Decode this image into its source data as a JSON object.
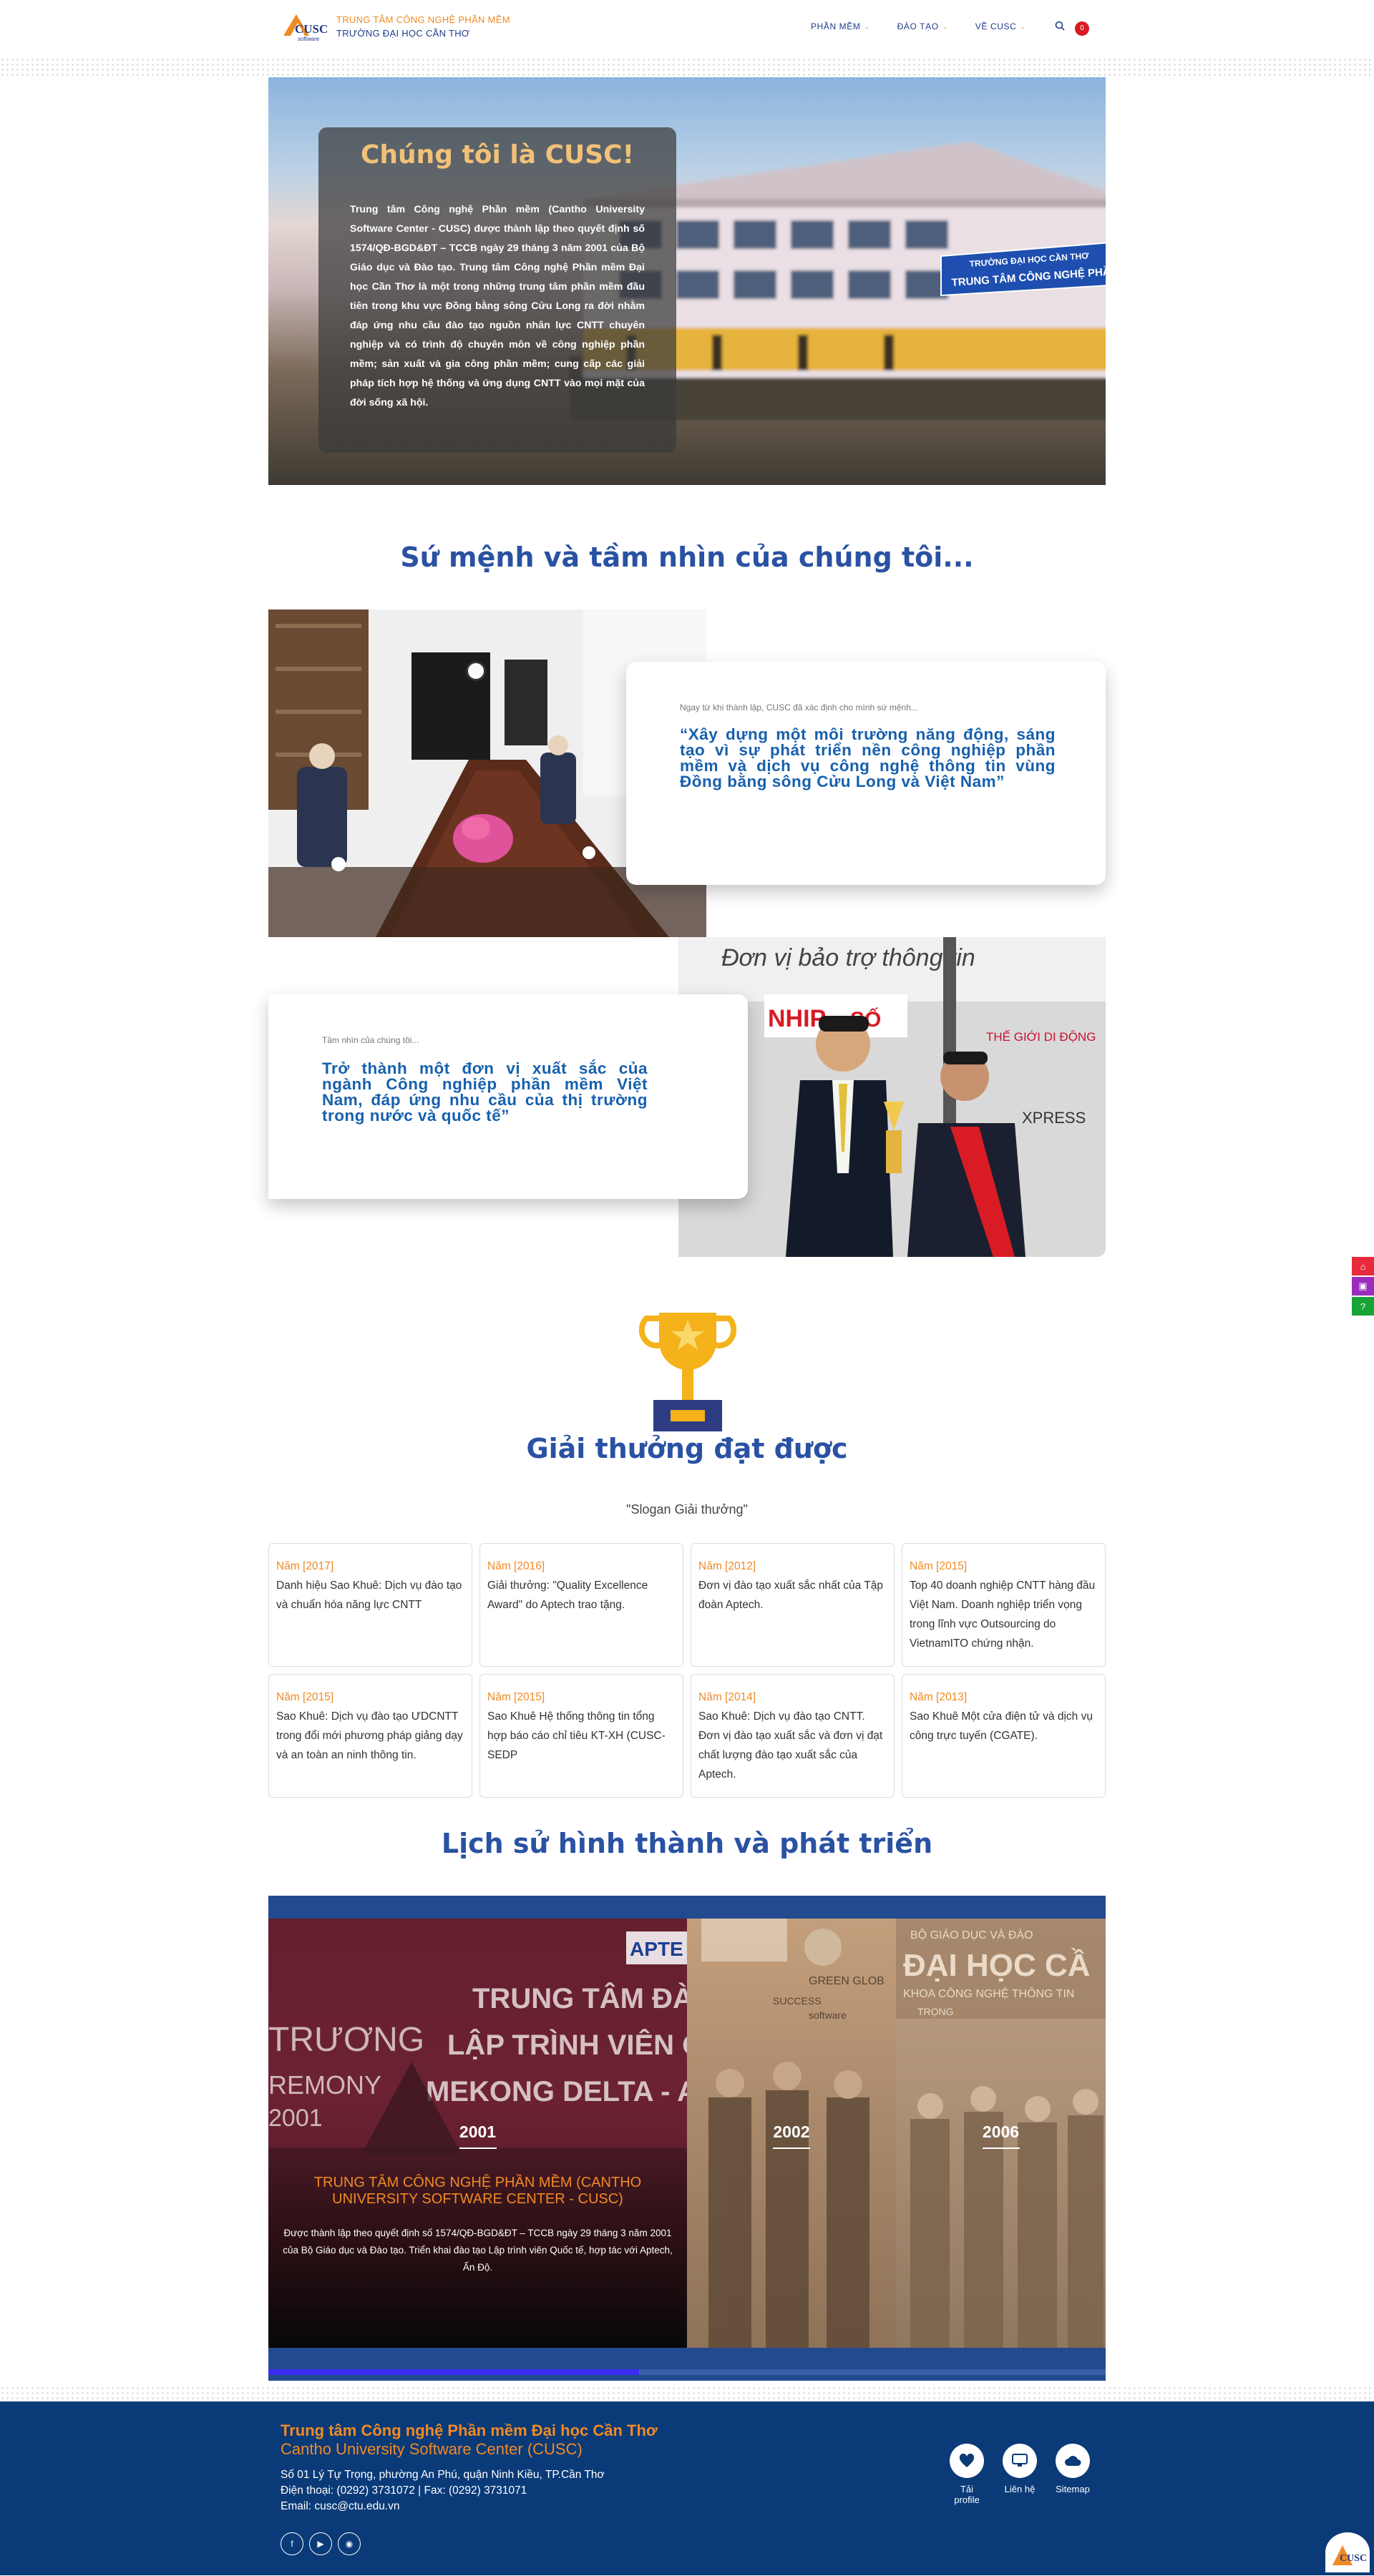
{
  "header": {
    "logo_line1": "TRUNG TÂM CÔNG NGHỆ PHẦN MỀM",
    "logo_line2": "TRƯỜNG ĐẠI HỌC CẦN THƠ",
    "logo_mark": "CUSC",
    "logo_mark_sub": "software",
    "nav": [
      "PHẦN MỀM",
      "ĐÀO TẠO",
      "VỀ CUSC"
    ],
    "cart_count": "0"
  },
  "hero": {
    "title": "Chúng tôi là CUSC!",
    "body": "Trung tâm Công nghệ Phần mềm (Cantho University Software Center - CUSC) được thành lập theo quyết định số 1574/QĐ-BGD&ĐT – TCCB ngày 29 tháng 3 năm 2001 của Bộ Giáo dục và Đào tạo. Trung tâm Công nghệ Phần mềm Đại học Cần Thơ là một trong những trung tâm phần mềm đầu tiên trong khu vực Đồng bằng sông Cửu Long ra đời nhằm đáp ứng nhu cầu đào tạo nguồn nhân lực CNTT chuyên nghiệp và có trình độ chuyên môn về công nghiệp phần mềm; sản xuất và gia công phần mềm; cung cấp các giải pháp tích hợp hệ thống và ứng dụng CNTT vào mọi mặt của đời sống xã hội.",
    "sign_line1": "TRƯỜNG ĐẠI HỌC CẦN THƠ",
    "sign_line2": "TRUNG TÂM CÔNG NGHỆ PHẦN MỀM"
  },
  "mission": {
    "title": "Sứ mệnh và tầm nhìn của chúng tôi...",
    "mission_intro": "Ngay từ khi thành lập, CUSC đã xác định cho mình sứ mệnh...",
    "mission_text": "“Xây dựng một môi trường năng động, sáng tạo vì sự phát triển nền công nghiệp phần mềm và dịch vụ công nghệ thông tin vùng Đồng bằng sông Cửu Long và Việt Nam”",
    "vision_intro": "Tầm nhìn của chúng tôi...",
    "vision_text": "Trở thành một đơn vị xuất sắc của ngành Công nghiệp phần mềm Việt Nam, đáp ứng nhu cầu của thị trường trong nước và quốc tế”",
    "banner_text": "Đơn vị bảo trợ thông tin",
    "logo_nhip": "NHIP",
    "logo_so": "SỐ",
    "logo_tgdd": "THẾ GIỚI DI ĐỘNG",
    "logo_express": "XPRESS"
  },
  "awards": {
    "title": "Giải thưởng đạt được",
    "slogan": "\"Slogan Giải thưởng\"",
    "items": [
      {
        "year": "Năm [2017]",
        "text": "Danh hiệu Sao Khuê: Dịch vụ đào tạo và chuẩn hóa năng lực CNTT"
      },
      {
        "year": "Năm [2016]",
        "text": "Giải thưởng: \"Quality Excellence Award\" do Aptech trao tặng."
      },
      {
        "year": "Năm [2012]",
        "text": "Đơn vị đào tạo xuất sắc nhất của Tập đoàn Aptech."
      },
      {
        "year": "Năm [2015]",
        "text": "Top 40 doanh nghiệp CNTT hàng đầu Việt Nam. Doanh nghiệp triển vọng trong lĩnh vực Outsourcing do VietnamITO chứng nhận."
      },
      {
        "year": "Năm [2015]",
        "text": "Sao Khuê: Dịch vụ đào tạo ƯDCNTT trong đổi mới phương pháp giảng dạy và an toàn an ninh thông tin."
      },
      {
        "year": "Năm [2015]",
        "text": "Sao Khuê Hệ thống thông tin tổng hợp báo cáo chỉ tiêu KT-XH (CUSC-SEDP"
      },
      {
        "year": "Năm [2014]",
        "text": "Sao Khuê: Dịch vụ đào tạo CNTT. Đơn vị đào tạo xuất sắc và đơn vị đạt chất lượng đào tạo xuất sắc của Aptech."
      },
      {
        "year": "Năm [2013]",
        "text": "Sao Khuê Một cửa điện tử và dịch vụ công trực tuyến (CGATE)."
      }
    ]
  },
  "history": {
    "title": "Lịch sử hình thành và phát triển",
    "panels": [
      {
        "year": "2001",
        "headline": "TRUNG TÂM CÔNG NGHỆ PHẦN MỀM (CANTHO UNIVERSITY SOFTWARE CENTER - CUSC)",
        "desc": "Được thành lập theo quyết định số 1574/QĐ-BGD&ĐT – TCCB ngày 29 tháng 3 năm 2001 của Bộ Giáo dục và Đào tạo. Triển khai đào tạo Lập trình viên Quốc tế, hợp tác với Aptech, Ấn Độ."
      },
      {
        "year": "2002"
      },
      {
        "year": "2006"
      }
    ],
    "backdrop_1": "TRUNG TÂM ĐÀO",
    "backdrop_2": "LẬP TRÌNH VIÊN QU",
    "backdrop_3": "MEKONG DELTA - A",
    "backdrop_4": "TRƯƠNG",
    "backdrop_5": "REMONY",
    "backdrop_6": "2001",
    "backdrop_aptech": "APTE",
    "backdrop_green": "GREEN GLOB",
    "backdrop_success": "SUCCESS",
    "backdrop_software": "software",
    "backdrop_dh": "ĐẠI HỌC CẦ",
    "backdrop_bo": "BỘ GIÁO DỤC VÀ ĐÀO",
    "backdrop_khoa": "KHOA CÔNG NGHỆ THÔNG TIN",
    "backdrop_trong": "TRỌNG",
    "progress": 0.443
  },
  "footer": {
    "title": "Trung tâm Công nghệ Phần mềm Đại học Cần Thơ",
    "subtitle": "Cantho University Software Center (CUSC)",
    "address": "Số 01 Lý Tự Trọng, phường An Phú, quận Ninh Kiều, TP.Cần Thơ",
    "phone": "Điện thoại: (0292) 3731072 | Fax: (0292) 3731071",
    "email": "Email: cusc@ctu.edu.vn",
    "links": [
      "Tải profile",
      "Liên hệ",
      "Sitemap"
    ]
  },
  "colors": {
    "accent": "#f08a24",
    "brand": "#1f3c88",
    "title": "#2a52a3",
    "footer": "#0a3a78"
  }
}
